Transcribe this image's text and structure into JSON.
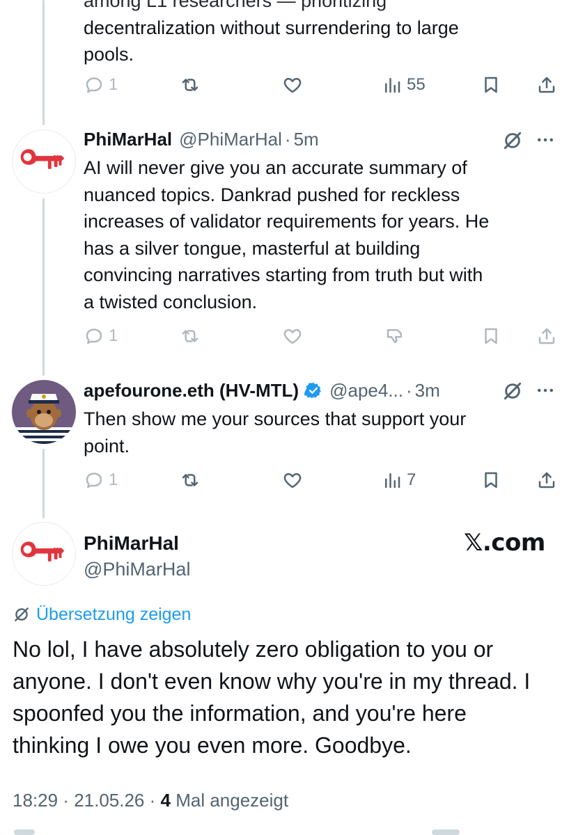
{
  "colors": {
    "text_primary": "#0f1419",
    "text_secondary": "#536471",
    "link_blue": "#1d9bf0",
    "thread_line": "#cfd9de",
    "verified_blue": "#1d9bf0",
    "key_red": "#e0353e"
  },
  "previous_tweet": {
    "text_lines": [
      "decentralization without surrendering to large",
      "pools."
    ],
    "actions": {
      "reply_count": "1",
      "views_count": "55"
    }
  },
  "tweet_phimarhal": {
    "display_name": "PhiMarHal",
    "handle": "@PhiMarHal",
    "dot": "·",
    "time": "5m",
    "avatar_icon": "red-key-icon",
    "text_lines": [
      "AI will never give you an accurate summary of",
      "nuanced topics. Dankrad pushed for reckless",
      "increases of validator requirements for years. He",
      "has a silver tongue, masterful at building",
      "convincing narratives starting from truth but with",
      "a twisted conclusion."
    ],
    "actions": {
      "reply_count": "1"
    }
  },
  "tweet_apefourone": {
    "display_name": "apefourone.eth (HV-MTL)",
    "handle": "@ape4...",
    "dot": "·",
    "time": "3m",
    "avatar_icon": "captain-ape-avatar",
    "verified_icon": "verified-badge-icon",
    "text_lines": [
      "Then show me your sources that support your",
      "point."
    ],
    "actions": {
      "reply_count": "1",
      "views_count": "7"
    }
  },
  "main_tweet": {
    "display_name": "PhiMarHal",
    "handle": "@PhiMarHal",
    "watermark": "𝕏.com",
    "translate_label": "Übersetzung zeigen",
    "text_lines": [
      "No lol, I have absolutely zero obligation to you or",
      "anyone. I don't even know why you're in my thread. I",
      "spoonfed you the information, and you're here",
      "thinking I owe you even more. Goodbye."
    ],
    "meta": {
      "time": "18:29",
      "sep1": " · ",
      "date": "21.05.26",
      "sep2": " · ",
      "views": "4",
      "views_label": " Mal angezeigt"
    }
  }
}
